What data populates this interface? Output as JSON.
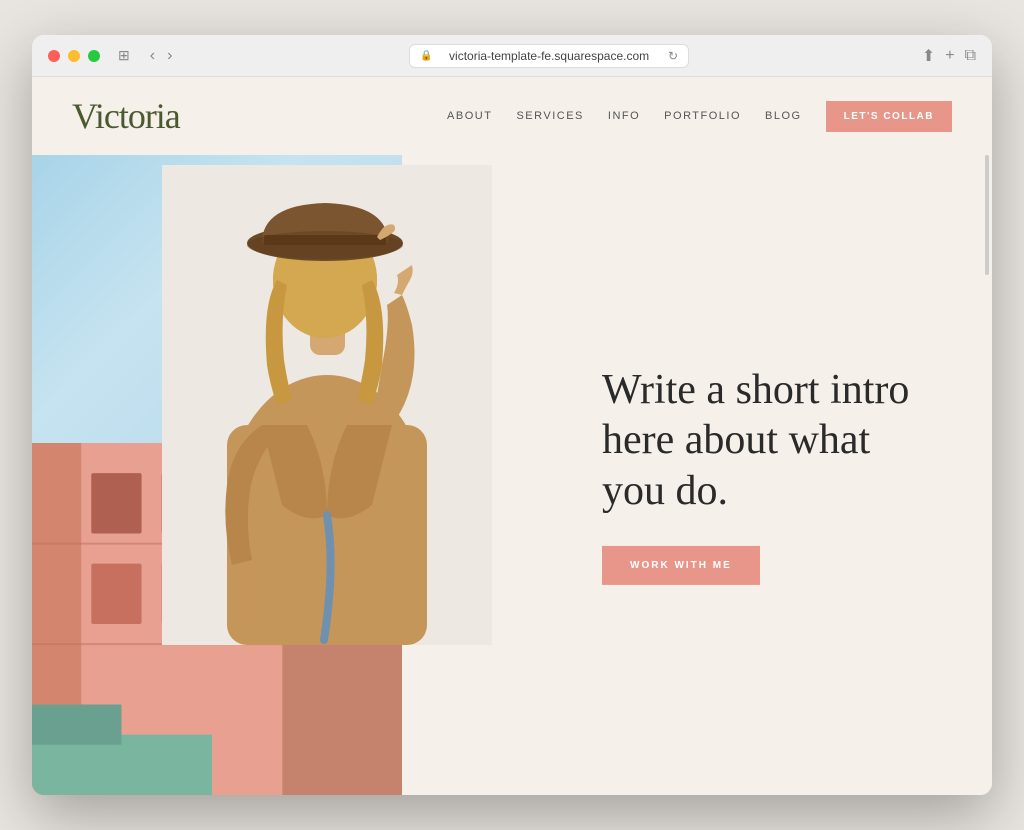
{
  "browser": {
    "url": "victoria-template-fe.squarespace.com",
    "back_label": "‹",
    "forward_label": "›",
    "reload_label": "↻",
    "share_label": "⬆",
    "new_tab_label": "+",
    "windows_label": "⧉"
  },
  "site": {
    "logo": "Victoria",
    "nav": {
      "items": [
        {
          "label": "ABOUT"
        },
        {
          "label": "SERVICES"
        },
        {
          "label": "INFO"
        },
        {
          "label": "PORTFOLIO"
        },
        {
          "label": "BLOG"
        }
      ],
      "cta_label": "LET'S COLLAB"
    },
    "hero": {
      "headline": "Write a short intro here about what you do.",
      "cta_label": "WORK WITH ME"
    }
  },
  "colors": {
    "logo": "#4a5a2e",
    "nav_cta_bg": "#e8968a",
    "work_btn_bg": "#e8968a",
    "cream_bg": "#f5f0ea",
    "sky": "#a8d4e8",
    "building": "#e8a090",
    "headline": "#2a2a2a"
  }
}
